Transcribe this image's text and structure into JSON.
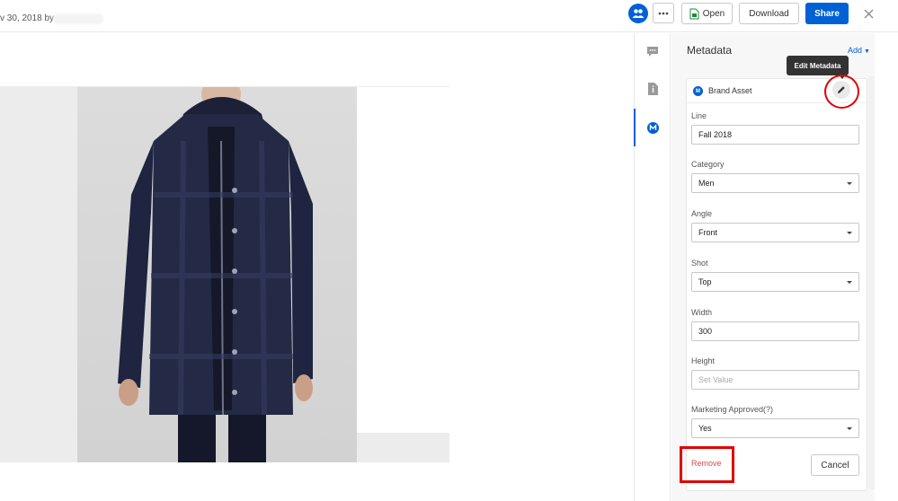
{
  "header": {
    "file_meta": "v 30, 2018 by",
    "open_label": "Open",
    "download_label": "Download",
    "share_label": "Share"
  },
  "sidebar_tabs": [
    "comments-icon",
    "file-info-icon",
    "metadata-icon"
  ],
  "metadata": {
    "title": "Metadata",
    "add_label": "Add",
    "tooltip": "Edit Metadata",
    "template_name": "Brand Asset",
    "template_icon_letter": "M",
    "fields": [
      {
        "label": "Line",
        "value": "Fall 2018",
        "type": "text"
      },
      {
        "label": "Category",
        "value": "Men",
        "type": "select"
      },
      {
        "label": "Angle",
        "value": "Front",
        "type": "select"
      },
      {
        "label": "Shot",
        "value": "Top",
        "type": "select"
      },
      {
        "label": "Width",
        "value": "300",
        "type": "text"
      },
      {
        "label": "Height",
        "placeholder": "Set Value",
        "type": "text"
      },
      {
        "label": "Marketing Approved(?)",
        "value": "Yes",
        "type": "select"
      }
    ],
    "remove_label": "Remove",
    "cancel_label": "Cancel"
  },
  "colors": {
    "accent": "#0061d5",
    "annotation": "#e00000",
    "remove_text": "#d94a4a"
  }
}
